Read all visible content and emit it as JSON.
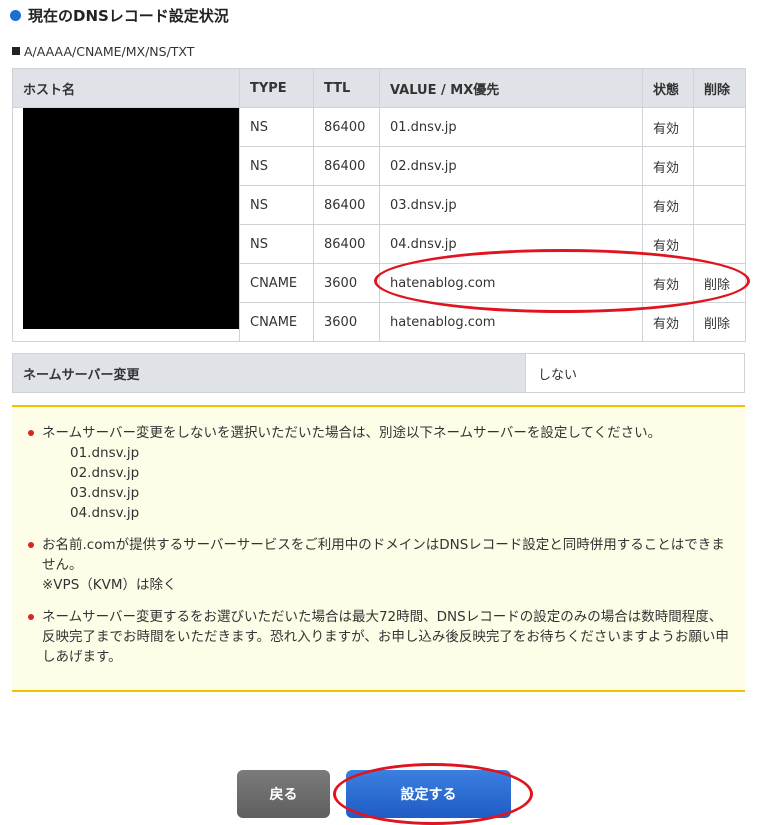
{
  "header": {
    "title": "現在のDNSレコード設定状況"
  },
  "record_types": "A/AAAA/CNAME/MX/NS/TXT",
  "table": {
    "columns": [
      "ホスト名",
      "TYPE",
      "TTL",
      "VALUE / MX優先",
      "状態",
      "削除"
    ],
    "rows": [
      {
        "type": "NS",
        "ttl": "86400",
        "value": "01.dnsv.jp",
        "status": "有効",
        "delete": ""
      },
      {
        "type": "NS",
        "ttl": "86400",
        "value": "02.dnsv.jp",
        "status": "有効",
        "delete": ""
      },
      {
        "type": "NS",
        "ttl": "86400",
        "value": "03.dnsv.jp",
        "status": "有効",
        "delete": ""
      },
      {
        "type": "NS",
        "ttl": "86400",
        "value": "04.dnsv.jp",
        "status": "有効",
        "delete": ""
      },
      {
        "type": "CNAME",
        "ttl": "3600",
        "value": "hatenablog.com",
        "status": "有効",
        "delete": "削除"
      },
      {
        "type": "CNAME",
        "ttl": "3600",
        "value": "hatenablog.com",
        "status": "有効",
        "delete": "削除"
      }
    ]
  },
  "ns_change": {
    "label": "ネームサーバー変更",
    "value": "しない"
  },
  "notice": {
    "item1": "ネームサーバー変更をしないを選択いただいた場合は、別途以下ネームサーバーを設定してください。",
    "nameservers": [
      "01.dnsv.jp",
      "02.dnsv.jp",
      "03.dnsv.jp",
      "04.dnsv.jp"
    ],
    "item2": "お名前.comが提供するサーバーサービスをご利用中のドメインはDNSレコード設定と同時併用することはできません。",
    "item2_note": "※VPS（KVM）は除く",
    "item3": "ネームサーバー変更するをお選びいただいた場合は最大72時間、DNSレコードの設定のみの場合は数時間程度、反映完了までお時間をいただきます。恐れ入りますが、お申し込み後反映完了をお待ちくださいますようお願い申しあげます。"
  },
  "buttons": {
    "back": "戻る",
    "submit": "設定する"
  },
  "colors": {
    "accent": "#1a6fd6",
    "annotation": "#e0141e",
    "notice_border": "#f2c200"
  }
}
